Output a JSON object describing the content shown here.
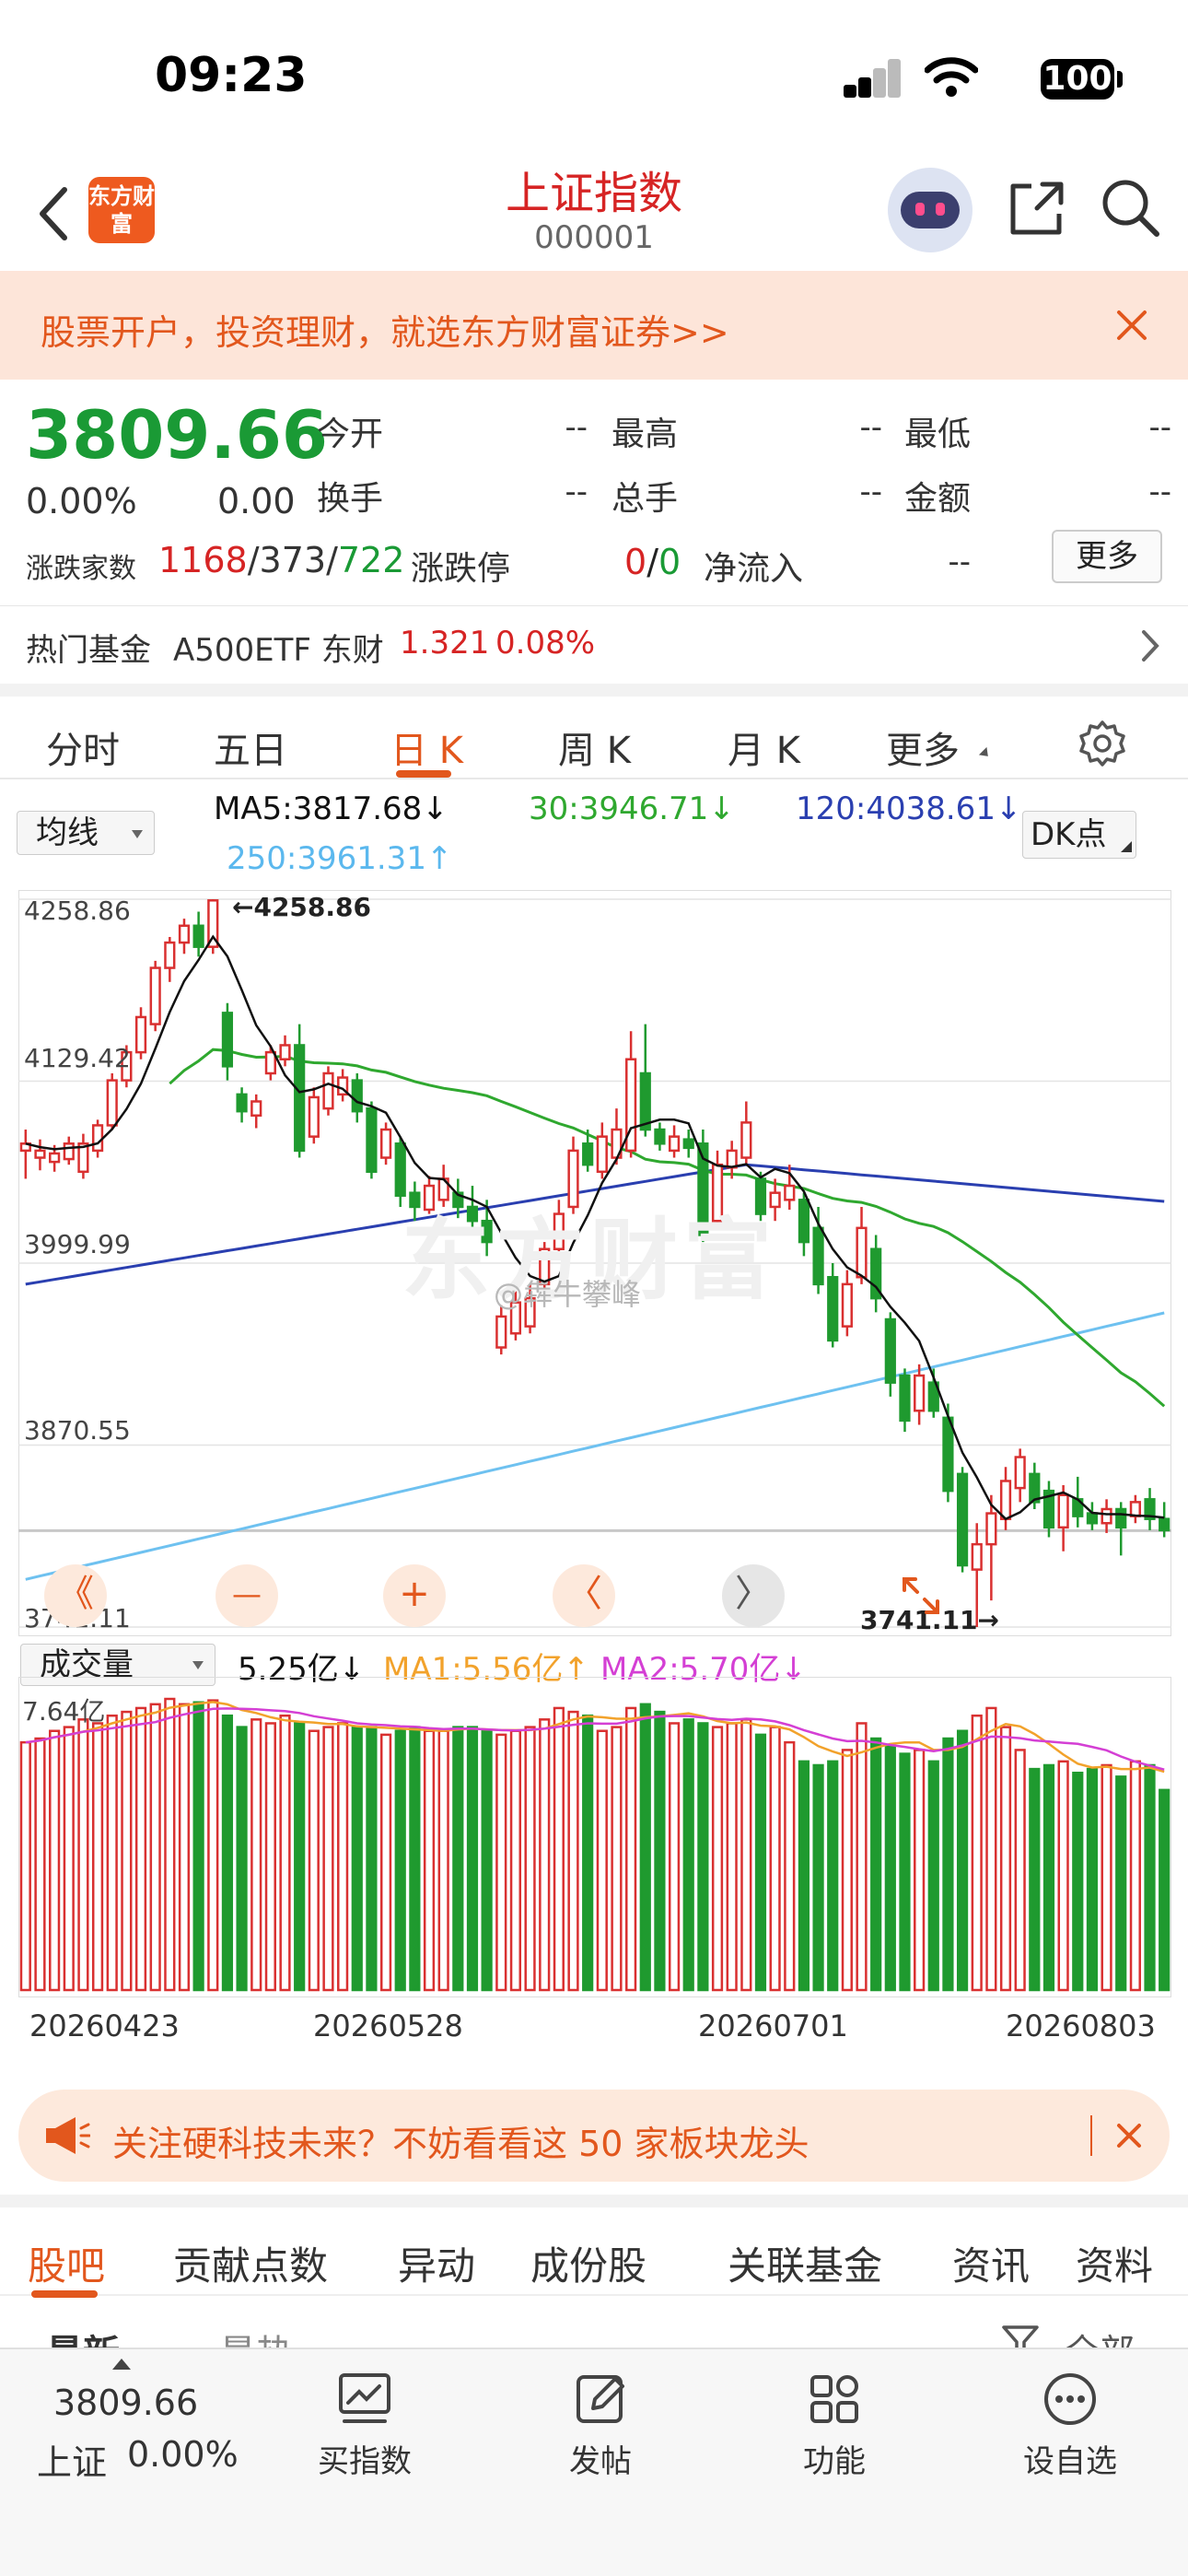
{
  "status": {
    "time": "09:23",
    "battery": "100"
  },
  "header": {
    "title": "上证指数",
    "code": "000001",
    "logo_text": "东方财富"
  },
  "banner": {
    "text": "股票开户，投资理财，就选东方财富证券>>"
  },
  "quote": {
    "price": "3809.66",
    "change_pct": "0.00%",
    "change": "0.00",
    "open_label": "今开",
    "open": "--",
    "high_label": "最高",
    "high": "--",
    "low_label": "最低",
    "low": "--",
    "turnover_label": "换手",
    "turnover": "--",
    "volume_label": "总手",
    "volume": "--",
    "amount_label": "金额",
    "amount": "--",
    "breadth_label": "涨跌家数",
    "up": "1168",
    "flat": "373",
    "down": "722",
    "limit_label": "涨跌停",
    "limit_up": "0",
    "limit_down": "0",
    "inflow_label": "净流入",
    "inflow": "--",
    "more": "更多",
    "fund_label": "热门基金",
    "fund_name": "A500ETF 东财",
    "fund_price": "1.321",
    "fund_pct": "0.08%"
  },
  "tabs": {
    "t1": "分时",
    "t2": "五日",
    "t3": "日 K",
    "t4": "周 K",
    "t5": "月 K",
    "t6": "更多"
  },
  "chart_header": {
    "indicator": "均线",
    "ma5": "MA5:3817.68",
    "ma30": "30:3946.71",
    "ma120": "120:4038.61",
    "ma250": "250:3961.31",
    "dk": "DK点",
    "vol_indicator": "成交量",
    "vol": "5.25亿",
    "vma1": "MA1:5.56亿",
    "vma2": "MA2:5.70亿"
  },
  "watermark": "东方财富",
  "weibo": "@犇牛攀峰",
  "chart_data": {
    "type": "candlestick",
    "y_ticks": [
      "4258.86",
      "4129.42",
      "3999.99",
      "3870.55",
      "3741.11"
    ],
    "ylim": [
      3741.11,
      4258.86
    ],
    "high_mark": "4258.86",
    "low_mark": "3741.11",
    "vol_max": "7.64亿",
    "x_ticks": [
      "20260423",
      "20260528",
      "20260701",
      "20260803"
    ],
    "colors": {
      "up": "#d93030",
      "down": "#1f9a2f",
      "ma5": "#111111",
      "ma30": "#2fa82f",
      "ma120": "#2a3fb0",
      "ma250": "#6ec1f0",
      "vma1": "#f2a22b",
      "vma2": "#d43fd4"
    },
    "candles": [
      [
        4080,
        4085,
        4060,
        4095
      ],
      [
        4075,
        4080,
        4066,
        4088
      ],
      [
        4072,
        4078,
        4065,
        4084
      ],
      [
        4074,
        4085,
        4070,
        4090
      ],
      [
        4065,
        4085,
        4060,
        4092
      ],
      [
        4080,
        4098,
        4075,
        4102
      ],
      [
        4098,
        4130,
        4095,
        4135
      ],
      [
        4130,
        4150,
        4125,
        4155
      ],
      [
        4150,
        4175,
        4145,
        4182
      ],
      [
        4170,
        4210,
        4165,
        4215
      ],
      [
        4210,
        4228,
        4200,
        4232
      ],
      [
        4228,
        4240,
        4220,
        4245
      ],
      [
        4240,
        4225,
        4218,
        4250
      ],
      [
        4225,
        4258,
        4220,
        4258.86
      ],
      [
        4178,
        4140,
        4130,
        4185
      ],
      [
        4120,
        4108,
        4100,
        4125
      ],
      [
        4105,
        4115,
        4096,
        4120
      ],
      [
        4135,
        4150,
        4130,
        4155
      ],
      [
        4145,
        4155,
        4140,
        4162
      ],
      [
        4155,
        4080,
        4075,
        4170
      ],
      [
        4090,
        4118,
        4085,
        4125
      ],
      [
        4110,
        4135,
        4105,
        4140
      ],
      [
        4120,
        4132,
        4115,
        4138
      ],
      [
        4130,
        4108,
        4100,
        4135
      ],
      [
        4110,
        4065,
        4060,
        4115
      ],
      [
        4075,
        4095,
        4070,
        4100
      ],
      [
        4085,
        4048,
        4040,
        4090
      ],
      [
        4050,
        4040,
        4030,
        4058
      ],
      [
        4038,
        4055,
        4035,
        4062
      ],
      [
        4045,
        4060,
        4040,
        4070
      ],
      [
        4050,
        4040,
        4032,
        4060
      ],
      [
        4040,
        4030,
        4025,
        4055
      ],
      [
        4030,
        4015,
        4005,
        4045
      ],
      [
        3940,
        3962,
        3935,
        3970
      ],
      [
        3950,
        3972,
        3945,
        3980
      ],
      [
        3955,
        3975,
        3950,
        3985
      ],
      [
        3985,
        4010,
        3980,
        4015
      ],
      [
        4010,
        4035,
        4005,
        4045
      ],
      [
        4040,
        4080,
        4035,
        4090
      ],
      [
        4085,
        4070,
        4065,
        4095
      ],
      [
        4065,
        4090,
        4060,
        4100
      ],
      [
        4075,
        4095,
        4070,
        4110
      ],
      [
        4080,
        4145,
        4075,
        4165
      ],
      [
        4135,
        4095,
        4090,
        4170
      ],
      [
        4095,
        4085,
        4080,
        4100
      ],
      [
        4080,
        4090,
        4075,
        4098
      ],
      [
        4088,
        4082,
        4075,
        4095
      ],
      [
        4085,
        4020,
        4015,
        4095
      ],
      [
        4030,
        4070,
        4025,
        4080
      ],
      [
        4068,
        4080,
        4060,
        4087
      ],
      [
        4075,
        4100,
        4070,
        4115
      ],
      [
        4060,
        4035,
        4030,
        4065
      ],
      [
        4040,
        4050,
        4030,
        4060
      ],
      [
        4045,
        4055,
        4038,
        4070
      ],
      [
        4045,
        4015,
        4005,
        4050
      ],
      [
        4025,
        3985,
        3978,
        4040
      ],
      [
        3990,
        3945,
        3940,
        4000
      ],
      [
        3955,
        3985,
        3948,
        3995
      ],
      [
        3990,
        4025,
        3985,
        4040
      ],
      [
        4010,
        3975,
        3965,
        4020
      ],
      [
        3960,
        3915,
        3905,
        3965
      ],
      [
        3920,
        3888,
        3880,
        3925
      ],
      [
        3895,
        3920,
        3885,
        3928
      ],
      [
        3915,
        3895,
        3890,
        3925
      ],
      [
        3890,
        3838,
        3830,
        3900
      ],
      [
        3850,
        3785,
        3780,
        3855
      ],
      [
        3782,
        3800,
        3741.11,
        3815
      ],
      [
        3800,
        3822,
        3760,
        3835
      ],
      [
        3818,
        3845,
        3810,
        3855
      ],
      [
        3840,
        3862,
        3830,
        3868
      ],
      [
        3850,
        3830,
        3825,
        3858
      ],
      [
        3838,
        3812,
        3805,
        3845
      ],
      [
        3812,
        3835,
        3795,
        3842
      ],
      [
        3832,
        3820,
        3812,
        3848
      ],
      [
        3822,
        3815,
        3810,
        3830
      ],
      [
        3815,
        3825,
        3808,
        3832
      ],
      [
        3825,
        3812,
        3792,
        3830
      ],
      [
        3820,
        3830,
        3815,
        3835
      ],
      [
        3832,
        3818,
        3810,
        3840
      ],
      [
        3818,
        3810,
        3805,
        3830
      ]
    ],
    "volumes": [
      6.5,
      6.6,
      6.8,
      6.9,
      7.1,
      7.0,
      7.2,
      7.3,
      7.4,
      7.5,
      7.64,
      7.5,
      7.55,
      7.6,
      7.2,
      6.9,
      7.1,
      7.0,
      7.2,
      7.0,
      6.8,
      6.9,
      7.0,
      6.9,
      6.9,
      6.7,
      6.8,
      6.9,
      6.8,
      6.8,
      6.9,
      6.9,
      6.8,
      6.7,
      6.8,
      6.9,
      7.1,
      7.4,
      7.3,
      7.2,
      6.8,
      6.9,
      7.4,
      7.5,
      7.3,
      7.0,
      7.1,
      7.0,
      6.9,
      7.0,
      7.1,
      6.7,
      6.9,
      6.5,
      6.0,
      5.9,
      6.0,
      6.3,
      7.0,
      6.6,
      6.4,
      6.2,
      6.3,
      6.0,
      6.6,
      6.8,
      7.2,
      7.4,
      6.9,
      6.3,
      5.8,
      5.9,
      6.0,
      5.7,
      5.8,
      5.9,
      5.6,
      6.0,
      5.9,
      5.25
    ]
  },
  "zoom": {
    "left": "《",
    "minus": "—",
    "plus": "+",
    "prev": "〈",
    "next": "〉"
  },
  "promo": {
    "text": "关注硬科技未来？不妨看看这 50 家板块龙头"
  },
  "subtabs": {
    "s1": "股吧",
    "s2": "贡献点数",
    "s3": "异动",
    "s4": "成份股",
    "s5": "关联基金",
    "s6": "资讯",
    "s7": "资料"
  },
  "peek": {
    "p1": "最新",
    "p2": "最热",
    "p3": "全部"
  },
  "bottom": {
    "price": "3809.66",
    "name": "上证",
    "pct": "0.00%",
    "buy": "买指数",
    "post": "发帖",
    "func": "功能",
    "watch": "设自选"
  }
}
